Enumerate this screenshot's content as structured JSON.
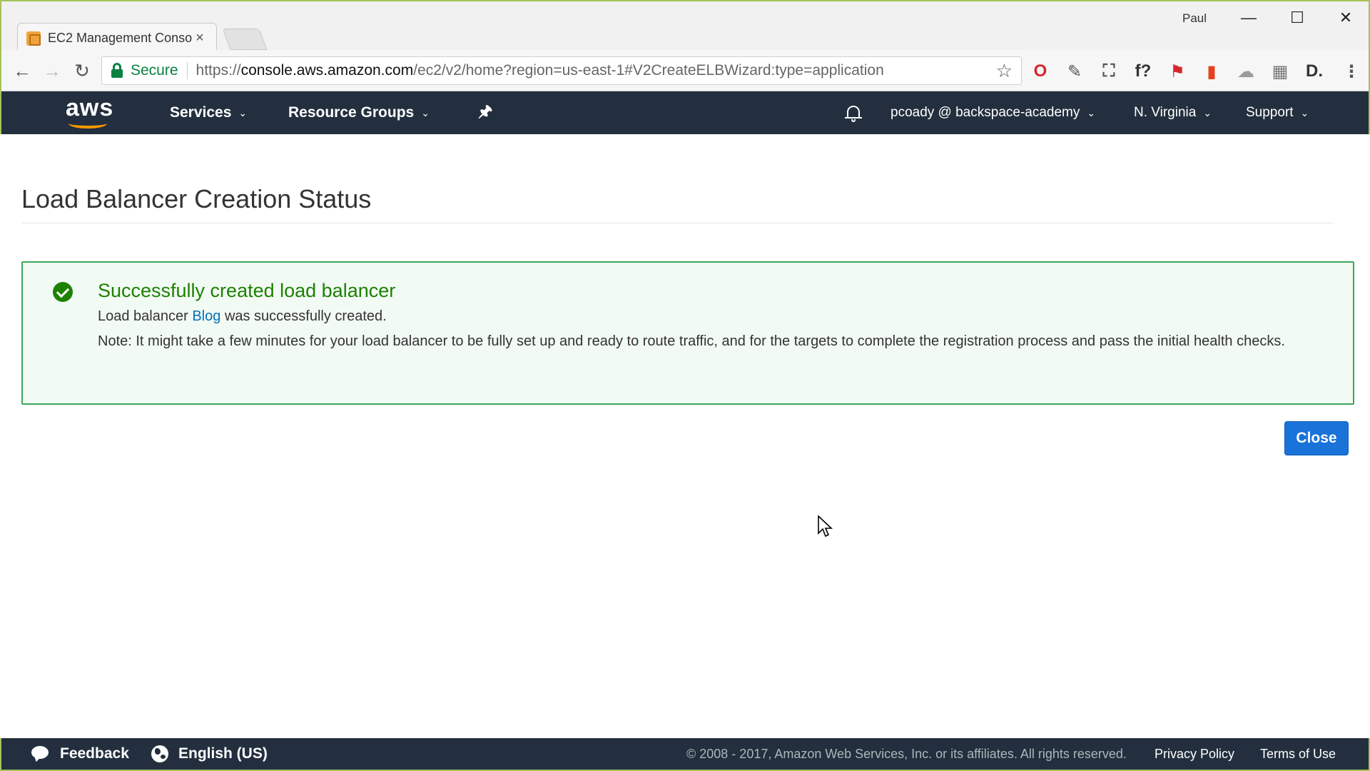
{
  "browser": {
    "tab_title": "EC2 Management Conso",
    "tab_close": "×",
    "profile_name": "Paul",
    "window_minimize": "—",
    "window_maximize": "☐",
    "window_close": "✕",
    "back": "←",
    "forward": "→",
    "reload": "↻",
    "secure_label": "Secure",
    "url_scheme": "https://",
    "url_host": "console.aws.amazon.com",
    "url_path": "/ec2/v2/home?region=us-east-1#V2CreateELBWizard:type=application",
    "bookmark_star": "☆",
    "menu": "⋮",
    "extensions": [
      {
        "name": "opera-icon",
        "glyph": "O",
        "color": "#d7262b"
      },
      {
        "name": "eyedropper-icon",
        "glyph": "✎",
        "color": "#555555"
      },
      {
        "name": "screenshot-icon",
        "glyph": "⛶",
        "color": "#555555"
      },
      {
        "name": "font-finder-icon",
        "glyph": "f?",
        "color": "#333333"
      },
      {
        "name": "flag-icon",
        "glyph": "⚑",
        "color": "#d7262b"
      },
      {
        "name": "office-icon",
        "glyph": "▮",
        "color": "#e8401c"
      },
      {
        "name": "cloud-icon",
        "glyph": "☁",
        "color": "#9a9a9a"
      },
      {
        "name": "extension-puzzle-icon",
        "glyph": "▦",
        "color": "#777777"
      },
      {
        "name": "d-extension-icon",
        "glyph": "D.",
        "color": "#333333"
      }
    ]
  },
  "aws_header": {
    "logo_text": "aws",
    "services": "Services",
    "resource_groups": "Resource Groups",
    "pin": "🖈",
    "account": "pcoady @ backspace-academy",
    "region": "N. Virginia",
    "support": "Support",
    "caret": "⌄"
  },
  "main": {
    "page_title": "Load Balancer Creation Status",
    "success": {
      "heading": "Successfully created load balancer",
      "line_prefix": "Load balancer",
      "lb_name": "Blog",
      "line_suffix": "was successfully created.",
      "note": "Note: It might take a few minutes for your load balancer to be fully set up and ready to route traffic, and for the targets to complete the registration process and pass the initial health checks."
    },
    "close_label": "Close"
  },
  "footer": {
    "feedback": "Feedback",
    "language": "English (US)",
    "copyright": "© 2008 - 2017, Amazon Web Services, Inc. or its affiliates. All rights reserved.",
    "privacy_policy": "Privacy Policy",
    "terms_of_use": "Terms of Use"
  },
  "colors": {
    "aws_header_bg": "#232f3e",
    "success_green": "#1d8102",
    "link_blue": "#0073bb",
    "primary_button": "#1a73d9",
    "aws_orange": "#ff9900"
  }
}
